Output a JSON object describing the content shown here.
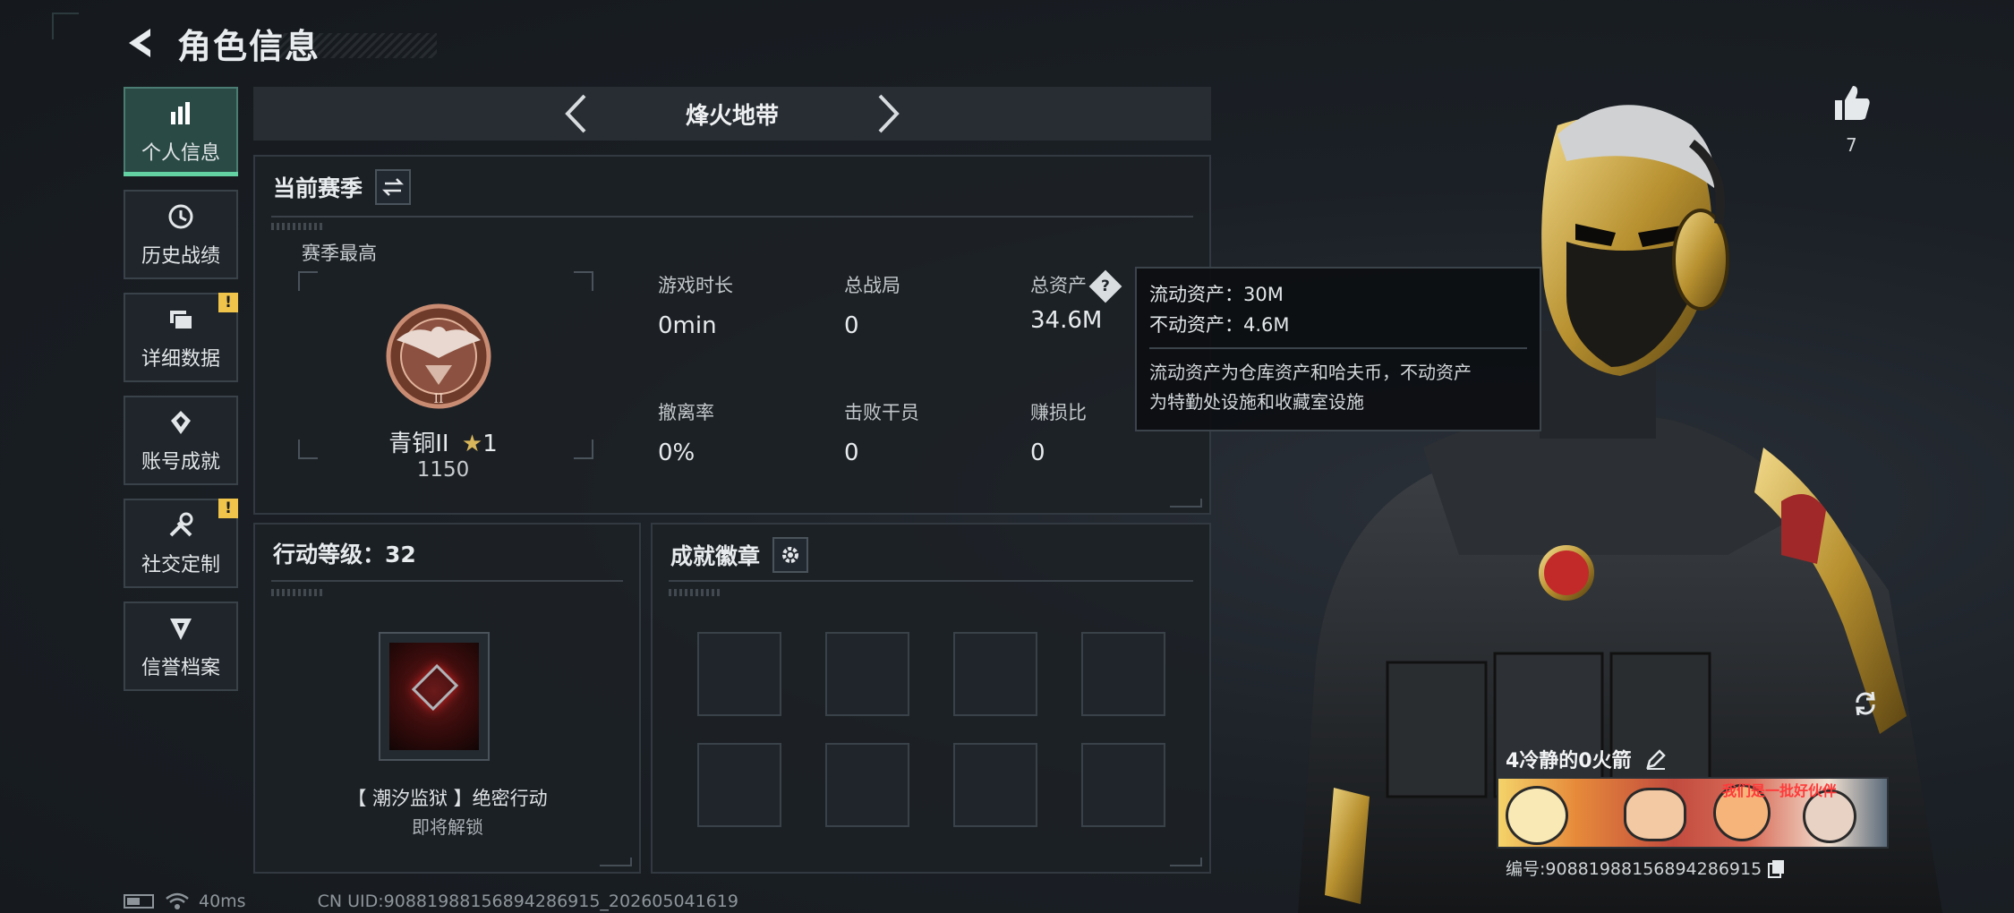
{
  "header": {
    "title": "角色信息"
  },
  "sidenav": [
    {
      "label": "个人信息",
      "icon": "bar-chart-icon",
      "active": true,
      "badge": ""
    },
    {
      "label": "历史战绩",
      "icon": "history-icon",
      "active": false,
      "badge": ""
    },
    {
      "label": "详细数据",
      "icon": "folder-icon",
      "active": false,
      "badge": "!"
    },
    {
      "label": "账号成就",
      "icon": "achievement-icon",
      "active": false,
      "badge": ""
    },
    {
      "label": "社交定制",
      "icon": "tools-icon",
      "active": false,
      "badge": "!"
    },
    {
      "label": "信誉档案",
      "icon": "reputation-icon",
      "active": false,
      "badge": ""
    }
  ],
  "mode": {
    "label": "烽火地带"
  },
  "season": {
    "title": "当前赛季",
    "sub": "赛季最高",
    "rank_name": "青铜II",
    "rank_stars": "1",
    "rank_points": "1150",
    "stats": [
      {
        "label": "游戏时长",
        "value": "0min"
      },
      {
        "label": "总战局",
        "value": "0"
      },
      {
        "label": "总资产",
        "value": "34.6M"
      },
      {
        "label": "撤离率",
        "value": "0%"
      },
      {
        "label": "击败干员",
        "value": "0"
      },
      {
        "label": "赚损比",
        "value": "0"
      }
    ]
  },
  "tooltip": {
    "line1": "流动资产：30M",
    "line2": "不动资产：4.6M",
    "desc1": "流动资产为仓库资产和哈夫币，不动资产",
    "desc2": "为特勤处设施和收藏室设施"
  },
  "level": {
    "title": "行动等级：32",
    "operation_name": "【 潮汐监狱 】绝密行动",
    "operation_status": "即将解锁"
  },
  "achievements": {
    "title": "成就徽章"
  },
  "character": {
    "likes": "7",
    "player_name": "4冷静的0火箭",
    "player_id": "编号:90881988156894286915",
    "banner_text": "我们是一批好伙伴"
  },
  "statusbar": {
    "ping": "40ms",
    "uid": "CN UID:90881988156894286915_202605041619"
  },
  "colors": {
    "accent": "#63d1a2",
    "badge": "#f0c44a",
    "panel_border": "#323940"
  }
}
